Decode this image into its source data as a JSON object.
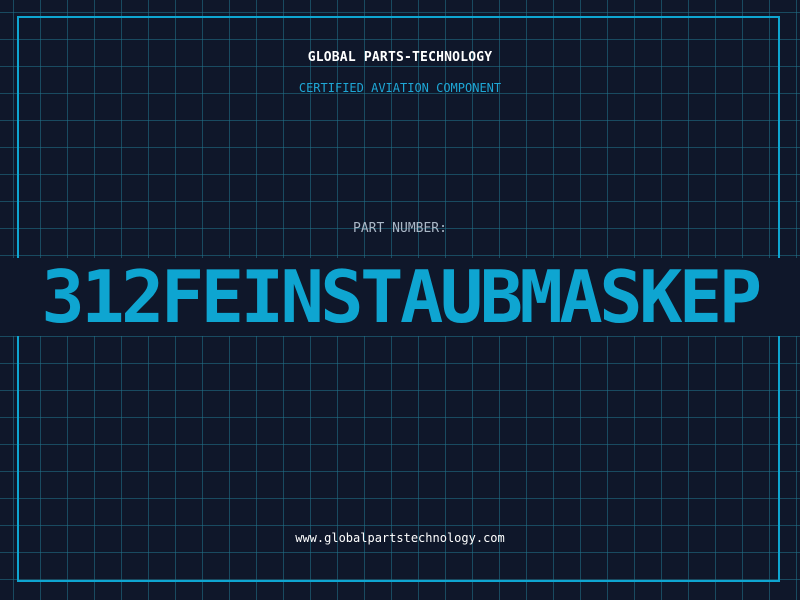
{
  "header": {
    "brand": "GLOBAL PARTS-TECHNOLOGY",
    "tagline": "CERTIFIED AVIATION COMPONENT"
  },
  "part": {
    "label": "PART NUMBER:",
    "number": "312FEINSTAUBMASKEP"
  },
  "footer": {
    "url": "www.globalpartstechnology.com"
  },
  "colors": {
    "background": "#0f172a",
    "grid": "#21758c",
    "accent": "#0ea5d1",
    "label": "#aab7c6",
    "text": "#ffffff"
  }
}
